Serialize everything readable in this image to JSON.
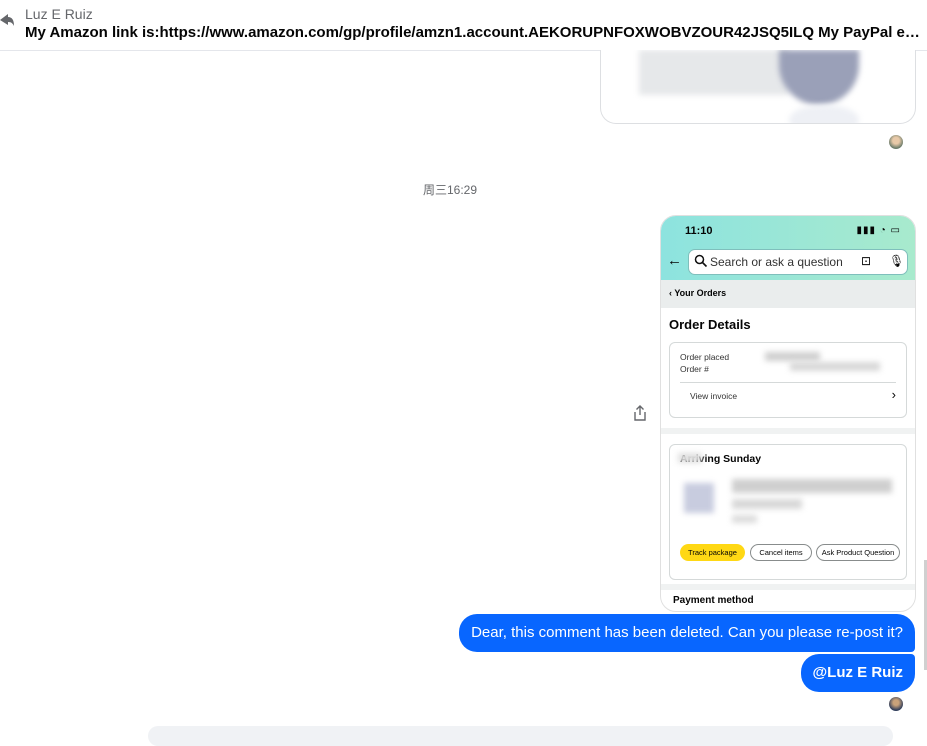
{
  "reply": {
    "name": "Luz E Ruiz",
    "text": "My Amazon link is:https://www.amazon.com/gp/profile/amzn1.account.AEKORUPNFOXWOBVZOUR42JSQ5ILQ My PayPal email is: ltouch..."
  },
  "timestamp": "周三16:29",
  "screenshot": {
    "status_time": "11:10",
    "search_placeholder": "Search or ask a question",
    "orders_link": "Your Orders",
    "title": "Order Details",
    "order_placed_label": "Order placed",
    "order_number_label": "Order #",
    "view_invoice": "View invoice",
    "arriving": "Arriving Sunday",
    "buttons": {
      "track": "Track package",
      "cancel": "Cancel items",
      "ask": "Ask Product Question"
    },
    "payment_method": "Payment method"
  },
  "messages": [
    {
      "text": "Dear, this comment has been deleted. Can you please re-post it?"
    },
    {
      "text": "@Luz E Ruiz"
    }
  ],
  "icons": [
    "reply-icon",
    "share-icon",
    "search-icon",
    "camera-icon",
    "mic-icon",
    "back-arrow-icon",
    "chevron-right-icon"
  ]
}
